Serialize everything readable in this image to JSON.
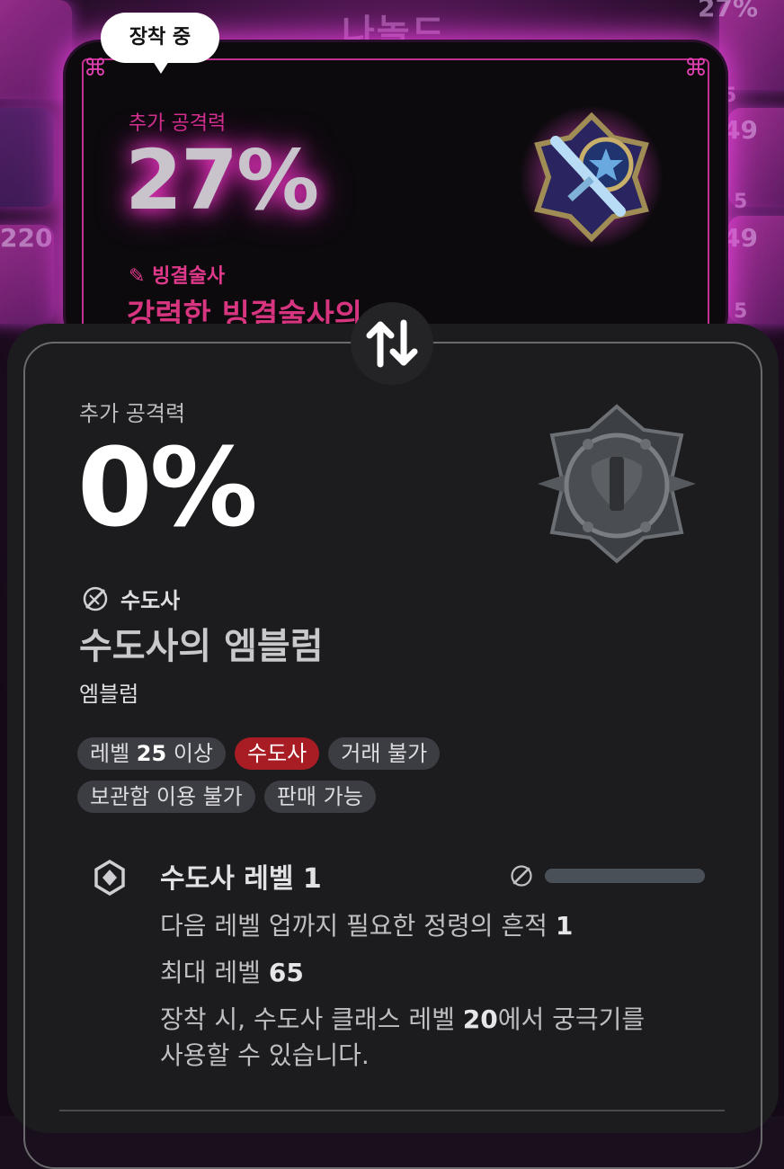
{
  "background": {
    "title": "나놀드",
    "numbers": [
      "27%",
      "5",
      "49",
      "220",
      "49",
      "5",
      "5",
      "5"
    ]
  },
  "equipped": {
    "badge": "장착 중",
    "stat_label": "추가 공격력",
    "stat_value": "27%",
    "class_name": "빙결술사",
    "item_name_partial": "강력한 빙결술사의"
  },
  "compare": {
    "swap_icon": "swap-arrows-icon",
    "stat_label": "추가 공격력",
    "stat_value": "0%",
    "class_name": "수도사",
    "item_name": "수도사의 엠블럼",
    "item_type": "엠블럼",
    "tags": [
      {
        "prefix": "레벨 ",
        "bold": "25",
        "suffix": " 이상",
        "style": "normal"
      },
      {
        "prefix": "수도사",
        "bold": "",
        "suffix": "",
        "style": "red"
      },
      {
        "prefix": "거래 불가",
        "bold": "",
        "suffix": "",
        "style": "normal"
      },
      {
        "prefix": "보관함 이용 불가",
        "bold": "",
        "suffix": "",
        "style": "normal"
      },
      {
        "prefix": "판매 가능",
        "bold": "",
        "suffix": "",
        "style": "normal"
      }
    ],
    "level": {
      "title": "수도사 레벨 1",
      "progress": 0,
      "next_prefix": "다음 레벨 업까지 필요한 정령의 흔적 ",
      "next_value": "1",
      "max_prefix": "최대 레벨 ",
      "max_value": "65",
      "effect_1_prefix": "장착 시, 수도사 클래스 레벨 ",
      "effect_1_value": "20",
      "effect_1_suffix": "에서 궁극기를",
      "effect_2": "사용할 수 있습니다."
    }
  },
  "colors": {
    "accent_pink": "#e040b0",
    "tag_red": "#a81d24",
    "card_bg": "#1c1c1e"
  }
}
